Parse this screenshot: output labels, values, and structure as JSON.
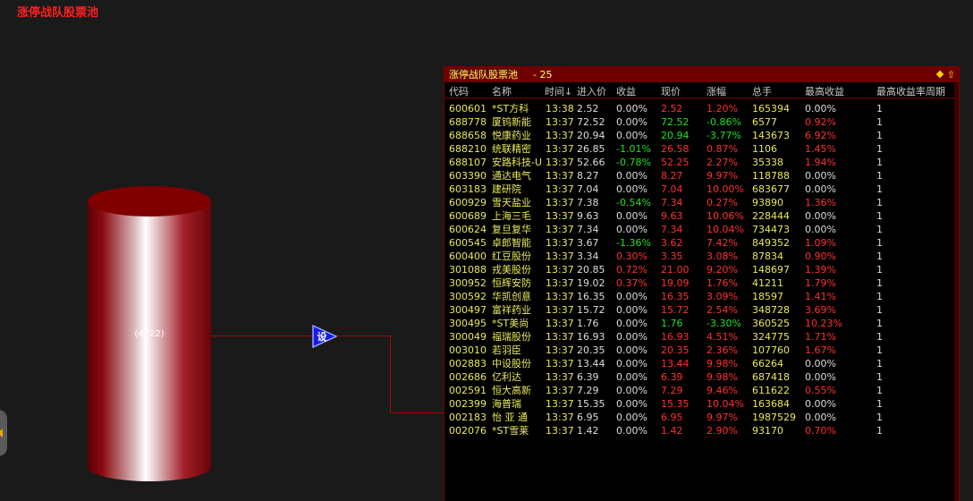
{
  "page": {
    "title": "涨停战队股票池",
    "colors": {
      "accent_red": "#ff2020",
      "up": "#ff3030",
      "down": "#20e020",
      "text_yellow": "#e8e85a"
    }
  },
  "flow": {
    "pool_count_label": "(4722)",
    "node_label": "设"
  },
  "window": {
    "title": "涨停战队股票池",
    "count": "- 25",
    "icons": [
      "diamond-icon",
      "arrow-up-icon"
    ],
    "columns": [
      "代码",
      "名称",
      "时间↓",
      "进入价",
      "收益",
      "现价",
      "涨幅",
      "总手",
      "最高收益",
      "最高收益率周期"
    ],
    "rows": [
      {
        "code": "600601",
        "name": "*ST方科",
        "time": "13:38",
        "entry": "2.52",
        "ret": "0.00%",
        "price": "2.52",
        "chg": "1.20%",
        "vol": "165394",
        "maxr": "0.00%",
        "cycle": "1",
        "ret_c": "white",
        "price_c": "red",
        "chg_c": "red",
        "maxr_c": "white"
      },
      {
        "code": "688778",
        "name": "厦钨新能",
        "time": "13:37",
        "entry": "72.52",
        "ret": "0.00%",
        "price": "72.52",
        "chg": "-0.86%",
        "vol": "6577",
        "maxr": "0.92%",
        "cycle": "1",
        "ret_c": "white",
        "price_c": "green",
        "chg_c": "green",
        "maxr_c": "red"
      },
      {
        "code": "688658",
        "name": "悦康药业",
        "time": "13:37",
        "entry": "20.94",
        "ret": "0.00%",
        "price": "20.94",
        "chg": "-3.77%",
        "vol": "143673",
        "maxr": "6.92%",
        "cycle": "1",
        "ret_c": "white",
        "price_c": "green",
        "chg_c": "green",
        "maxr_c": "red"
      },
      {
        "code": "688210",
        "name": "统联精密",
        "time": "13:37",
        "entry": "26.85",
        "ret": "-1.01%",
        "price": "26.58",
        "chg": "0.87%",
        "vol": "1106",
        "maxr": "1.45%",
        "cycle": "1",
        "ret_c": "green",
        "price_c": "red",
        "chg_c": "red",
        "maxr_c": "red"
      },
      {
        "code": "688107",
        "name": "安路科技-U",
        "time": "13:37",
        "entry": "52.66",
        "ret": "-0.78%",
        "price": "52.25",
        "chg": "2.27%",
        "vol": "35338",
        "maxr": "1.94%",
        "cycle": "1",
        "ret_c": "green",
        "price_c": "red",
        "chg_c": "red",
        "maxr_c": "red"
      },
      {
        "code": "603390",
        "name": "通达电气",
        "time": "13:37",
        "entry": "8.27",
        "ret": "0.00%",
        "price": "8.27",
        "chg": "9.97%",
        "vol": "118788",
        "maxr": "0.00%",
        "cycle": "1",
        "ret_c": "white",
        "price_c": "red",
        "chg_c": "red",
        "maxr_c": "white"
      },
      {
        "code": "603183",
        "name": "建研院",
        "time": "13:37",
        "entry": "7.04",
        "ret": "0.00%",
        "price": "7.04",
        "chg": "10.00%",
        "vol": "683677",
        "maxr": "0.00%",
        "cycle": "1",
        "ret_c": "white",
        "price_c": "red",
        "chg_c": "red",
        "maxr_c": "white"
      },
      {
        "code": "600929",
        "name": "雪天盐业",
        "time": "13:37",
        "entry": "7.38",
        "ret": "-0.54%",
        "price": "7.34",
        "chg": "0.27%",
        "vol": "93890",
        "maxr": "1.36%",
        "cycle": "1",
        "ret_c": "green",
        "price_c": "red",
        "chg_c": "red",
        "maxr_c": "red"
      },
      {
        "code": "600689",
        "name": "上海三毛",
        "time": "13:37",
        "entry": "9.63",
        "ret": "0.00%",
        "price": "9.63",
        "chg": "10.06%",
        "vol": "228444",
        "maxr": "0.00%",
        "cycle": "1",
        "ret_c": "white",
        "price_c": "red",
        "chg_c": "red",
        "maxr_c": "white"
      },
      {
        "code": "600624",
        "name": "复旦复华",
        "time": "13:37",
        "entry": "7.34",
        "ret": "0.00%",
        "price": "7.34",
        "chg": "10.04%",
        "vol": "734473",
        "maxr": "0.00%",
        "cycle": "1",
        "ret_c": "white",
        "price_c": "red",
        "chg_c": "red",
        "maxr_c": "white"
      },
      {
        "code": "600545",
        "name": "卓郎智能",
        "time": "13:37",
        "entry": "3.67",
        "ret": "-1.36%",
        "price": "3.62",
        "chg": "7.42%",
        "vol": "849352",
        "maxr": "1.09%",
        "cycle": "1",
        "ret_c": "green",
        "price_c": "red",
        "chg_c": "red",
        "maxr_c": "red"
      },
      {
        "code": "600400",
        "name": "红豆股份",
        "time": "13:37",
        "entry": "3.34",
        "ret": "0.30%",
        "price": "3.35",
        "chg": "3.08%",
        "vol": "87834",
        "maxr": "0.90%",
        "cycle": "1",
        "ret_c": "red",
        "price_c": "red",
        "chg_c": "red",
        "maxr_c": "red"
      },
      {
        "code": "301088",
        "name": "戎美股份",
        "time": "13:37",
        "entry": "20.85",
        "ret": "0.72%",
        "price": "21.00",
        "chg": "9.20%",
        "vol": "148697",
        "maxr": "1.39%",
        "cycle": "1",
        "ret_c": "red",
        "price_c": "red",
        "chg_c": "red",
        "maxr_c": "red"
      },
      {
        "code": "300952",
        "name": "恒辉安防",
        "time": "13:37",
        "entry": "19.02",
        "ret": "0.37%",
        "price": "19.09",
        "chg": "1.76%",
        "vol": "41211",
        "maxr": "1.79%",
        "cycle": "1",
        "ret_c": "red",
        "price_c": "red",
        "chg_c": "red",
        "maxr_c": "red"
      },
      {
        "code": "300592",
        "name": "华凯创意",
        "time": "13:37",
        "entry": "16.35",
        "ret": "0.00%",
        "price": "16.35",
        "chg": "3.09%",
        "vol": "18597",
        "maxr": "1.41%",
        "cycle": "1",
        "ret_c": "white",
        "price_c": "red",
        "chg_c": "red",
        "maxr_c": "red"
      },
      {
        "code": "300497",
        "name": "富祥药业",
        "time": "13:37",
        "entry": "15.72",
        "ret": "0.00%",
        "price": "15.72",
        "chg": "2.54%",
        "vol": "348728",
        "maxr": "3.69%",
        "cycle": "1",
        "ret_c": "white",
        "price_c": "red",
        "chg_c": "red",
        "maxr_c": "red"
      },
      {
        "code": "300495",
        "name": "*ST美尚",
        "time": "13:37",
        "entry": "1.76",
        "ret": "0.00%",
        "price": "1.76",
        "chg": "-3.30%",
        "vol": "360525",
        "maxr": "10.23%",
        "cycle": "1",
        "ret_c": "white",
        "price_c": "green",
        "chg_c": "green",
        "maxr_c": "red"
      },
      {
        "code": "300049",
        "name": "福瑞股份",
        "time": "13:37",
        "entry": "16.93",
        "ret": "0.00%",
        "price": "16.93",
        "chg": "4.51%",
        "vol": "324775",
        "maxr": "1.71%",
        "cycle": "1",
        "ret_c": "white",
        "price_c": "red",
        "chg_c": "red",
        "maxr_c": "red"
      },
      {
        "code": "003010",
        "name": "若羽臣",
        "time": "13:37",
        "entry": "20.35",
        "ret": "0.00%",
        "price": "20.35",
        "chg": "2.36%",
        "vol": "107760",
        "maxr": "1.67%",
        "cycle": "1",
        "ret_c": "white",
        "price_c": "red",
        "chg_c": "red",
        "maxr_c": "red"
      },
      {
        "code": "002883",
        "name": "中设股份",
        "time": "13:37",
        "entry": "13.44",
        "ret": "0.00%",
        "price": "13.44",
        "chg": "9.98%",
        "vol": "66264",
        "maxr": "0.00%",
        "cycle": "1",
        "ret_c": "white",
        "price_c": "red",
        "chg_c": "red",
        "maxr_c": "white"
      },
      {
        "code": "002686",
        "name": "亿利达",
        "time": "13:37",
        "entry": "6.39",
        "ret": "0.00%",
        "price": "6.39",
        "chg": "9.98%",
        "vol": "687418",
        "maxr": "0.00%",
        "cycle": "1",
        "ret_c": "white",
        "price_c": "red",
        "chg_c": "red",
        "maxr_c": "white"
      },
      {
        "code": "002591",
        "name": "恒大高新",
        "time": "13:37",
        "entry": "7.29",
        "ret": "0.00%",
        "price": "7.29",
        "chg": "9.46%",
        "vol": "611622",
        "maxr": "0.55%",
        "cycle": "1",
        "ret_c": "white",
        "price_c": "red",
        "chg_c": "red",
        "maxr_c": "red"
      },
      {
        "code": "002399",
        "name": "海普瑞",
        "time": "13:37",
        "entry": "15.35",
        "ret": "0.00%",
        "price": "15.35",
        "chg": "10.04%",
        "vol": "163684",
        "maxr": "0.00%",
        "cycle": "1",
        "ret_c": "white",
        "price_c": "red",
        "chg_c": "red",
        "maxr_c": "white"
      },
      {
        "code": "002183",
        "name": "怡 亚 通",
        "time": "13:37",
        "entry": "6.95",
        "ret": "0.00%",
        "price": "6.95",
        "chg": "9.97%",
        "vol": "1987529",
        "maxr": "0.00%",
        "cycle": "1",
        "ret_c": "white",
        "price_c": "red",
        "chg_c": "red",
        "maxr_c": "white"
      },
      {
        "code": "002076",
        "name": "*ST雪莱",
        "time": "13:37",
        "entry": "1.42",
        "ret": "0.00%",
        "price": "1.42",
        "chg": "2.90%",
        "vol": "93170",
        "maxr": "0.70%",
        "cycle": "1",
        "ret_c": "white",
        "price_c": "red",
        "chg_c": "red",
        "maxr_c": "red"
      }
    ]
  }
}
